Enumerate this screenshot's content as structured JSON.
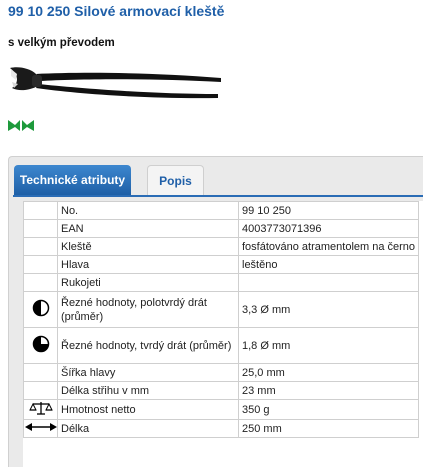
{
  "product": {
    "title": "99 10 250 Silové armovací kleště",
    "subtitle": "s velkým převodem"
  },
  "tabs": [
    {
      "label": "Technické atributy",
      "active": true
    },
    {
      "label": "Popis",
      "active": false
    }
  ],
  "attributes": [
    {
      "icon": "",
      "name": "No.",
      "value": "99 10 250"
    },
    {
      "icon": "",
      "name": "EAN",
      "value": "4003773071396"
    },
    {
      "icon": "",
      "name": "Kleště",
      "value": "fosfátováno atramentolem na černo"
    },
    {
      "icon": "",
      "name": "Hlava",
      "value": "leštěno"
    },
    {
      "icon": "",
      "name": "Rukojeti",
      "value": ""
    },
    {
      "icon": "half-circle-icon",
      "name": "Řezné hodnoty, polotvrdý drát (průměr)",
      "value": "3,3 Ø mm"
    },
    {
      "icon": "three-quarter-circle-icon",
      "name": "Řezné hodnoty, tvrdý drát (průměr)",
      "value": "1,8 Ø mm"
    },
    {
      "icon": "",
      "name": "Šířka hlavy",
      "value": "25,0 mm"
    },
    {
      "icon": "",
      "name": "Délka střihu v mm",
      "value": "23 mm"
    },
    {
      "icon": "scale-icon",
      "name": "Hmotnost netto",
      "value": "350 g"
    },
    {
      "icon": "double-arrow-icon",
      "name": "Délka",
      "value": "250 mm"
    }
  ],
  "colors": {
    "title": "#1f5fa8",
    "tab_active": "#2a6cb5",
    "badge_green": "#1e9a3c"
  }
}
